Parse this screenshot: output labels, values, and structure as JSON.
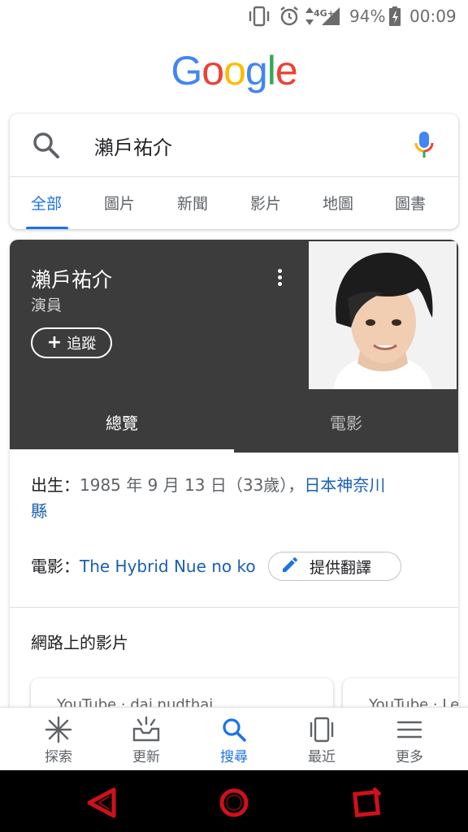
{
  "status_bar": {
    "network": "4G+",
    "battery": "94%",
    "time": "00:09",
    "icons": [
      "vibrate-icon",
      "alarm-icon",
      "data-arrows-icon",
      "signal-icon",
      "battery-icon"
    ]
  },
  "logo": {
    "text": "Google",
    "colors": [
      "#4285F4",
      "#EA4335",
      "#FBBC05",
      "#4285F4",
      "#34A853",
      "#EA4335"
    ]
  },
  "search": {
    "query": "瀨戶祐介",
    "icons": [
      "search-icon",
      "mic-icon"
    ]
  },
  "tabs": [
    {
      "label": "全部",
      "active": true
    },
    {
      "label": "圖片"
    },
    {
      "label": "新聞"
    },
    {
      "label": "影片"
    },
    {
      "label": "地圖"
    },
    {
      "label": "圖書"
    }
  ],
  "knowledge_panel": {
    "title": "瀨戶祐介",
    "subtitle": "演員",
    "follow_label": "追蹤",
    "tabs": [
      {
        "label": "總覽",
        "active": true
      },
      {
        "label": "電影"
      }
    ],
    "facts": {
      "born_label": "出生：",
      "born_value": "1985 年 9 月 13 日（33歲），",
      "born_place_line1": "日本神奈川",
      "born_place_line2": "縣",
      "films_label": "電影：",
      "films_value": "The Hybrid Nue no ko",
      "translate_label": "提供翻譯"
    },
    "videos_heading": "網路上的影片",
    "videos": [
      {
        "source": "YouTube · dai nudthai"
      },
      {
        "source": "YouTube · Lev"
      }
    ]
  },
  "bottom_nav": [
    {
      "label": "探索",
      "icon": "asterisk-icon"
    },
    {
      "label": "更新",
      "icon": "inbox-icon"
    },
    {
      "label": "搜尋",
      "icon": "search-icon",
      "active": true
    },
    {
      "label": "最近",
      "icon": "recent-cards-icon"
    },
    {
      "label": "更多",
      "icon": "menu-icon"
    }
  ],
  "system_nav": [
    "back-button",
    "home-button",
    "recents-button"
  ],
  "colors": {
    "accent": "#1a73e8",
    "panel_dark": "#3c3c3c",
    "sys_nav_red": "#d0101a"
  }
}
